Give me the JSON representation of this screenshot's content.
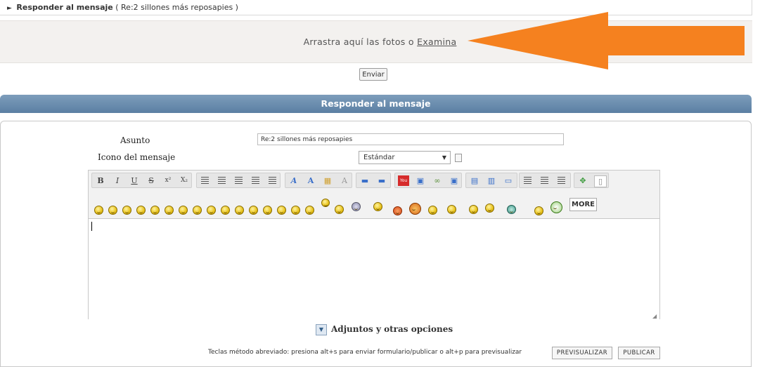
{
  "breadcrumb": {
    "prefix": "►",
    "title": "Responder al mensaje",
    "subtitle": "( Re:2 sillones más reposapies )"
  },
  "upload": {
    "text": "Arrastra aquí las fotos o",
    "link": "Examina",
    "send_button": "Enviar"
  },
  "reply_section": {
    "title": "Responder al mensaje"
  },
  "form": {
    "subject_label": "Asunto",
    "subject_value": "Re:2 sillones más reposapies",
    "icon_label": "Icono del mensaje",
    "icon_value": "Estándar"
  },
  "toolbar": {
    "bold": "B",
    "italic": "I",
    "underline": "U",
    "strike": "S",
    "superscript": "x²",
    "subscript": "X₂"
  },
  "emoticons": {
    "more_label": "MORE"
  },
  "attachments": {
    "label": "Adjuntos y otras opciones",
    "toggle_icon": "expand-arrow"
  },
  "footer": {
    "shortcut_hint": "Teclas método abreviado: presiona alt+s para enviar formulario/publicar o alt+p para previsualizar",
    "preview_button": "PREVISUALIZAR",
    "publish_button": "PUBLICAR"
  },
  "colors": {
    "accent_arrow": "#f5811f",
    "header_bar": "#6a8db0"
  }
}
